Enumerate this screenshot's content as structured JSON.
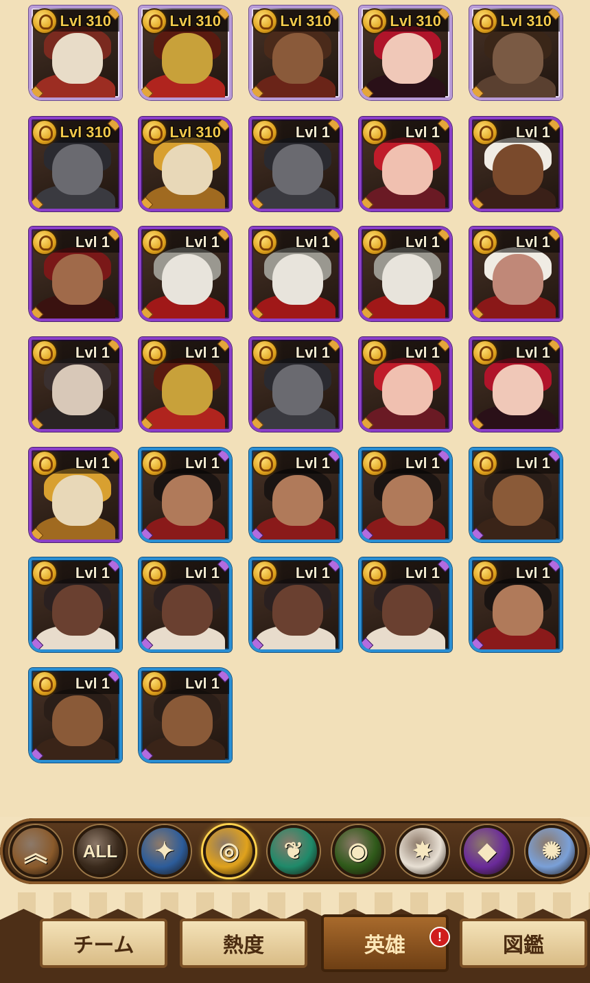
{
  "heroes": [
    {
      "level": "Lvl 310",
      "tier": "legend",
      "skin": "#e8dcc8",
      "hair": "#7a2a1f",
      "body": "#9c2d22"
    },
    {
      "level": "Lvl 310",
      "tier": "legend",
      "skin": "#c8a13a",
      "hair": "#5a1a10",
      "body": "#b0241e"
    },
    {
      "level": "Lvl 310",
      "tier": "legend",
      "skin": "#8a5a3a",
      "hair": "#4a2a1a",
      "body": "#6a2418"
    },
    {
      "level": "Lvl 310",
      "tier": "legend",
      "skin": "#f0c8b8",
      "hair": "#b0142a",
      "body": "#2a1018"
    },
    {
      "level": "Lvl 310",
      "tier": "legend",
      "skin": "#7a5a44",
      "hair": "#3a2618",
      "body": "#5a4030"
    },
    {
      "level": "Lvl 310",
      "tier": "purple",
      "skin": "#6a6a70",
      "hair": "#2a2a30",
      "body": "#3a3a40"
    },
    {
      "level": "Lvl 310",
      "tier": "purple",
      "skin": "#e8d8b8",
      "hair": "#d8a030",
      "body": "#a06a20"
    },
    {
      "level": "Lvl 1",
      "tier": "purple",
      "skin": "#6a6a70",
      "hair": "#2a2a30",
      "body": "#3a3a40"
    },
    {
      "level": "Lvl 1",
      "tier": "purple",
      "skin": "#f0c0b0",
      "hair": "#c01c2a",
      "body": "#6a1a24"
    },
    {
      "level": "Lvl 1",
      "tier": "purple",
      "skin": "#7a4a2c",
      "hair": "#f0ece4",
      "body": "#3a2018"
    },
    {
      "level": "Lvl 1",
      "tier": "purple",
      "skin": "#a06a4a",
      "hair": "#7a1818",
      "body": "#3a1210"
    },
    {
      "level": "Lvl 1",
      "tier": "purple",
      "skin": "#e8e4dc",
      "hair": "#9a9890",
      "body": "#a01818"
    },
    {
      "level": "Lvl 1",
      "tier": "purple",
      "skin": "#e8e4dc",
      "hair": "#9a9890",
      "body": "#a01818"
    },
    {
      "level": "Lvl 1",
      "tier": "purple",
      "skin": "#e8e4dc",
      "hair": "#9a9890",
      "body": "#a01818"
    },
    {
      "level": "Lvl 1",
      "tier": "purple",
      "skin": "#c08878",
      "hair": "#f0ece4",
      "body": "#8a1818"
    },
    {
      "level": "Lvl 1",
      "tier": "purple",
      "skin": "#d8c8b8",
      "hair": "#3a3030",
      "body": "#2a2424"
    },
    {
      "level": "Lvl 1",
      "tier": "purple",
      "skin": "#c8a13a",
      "hair": "#5a1a10",
      "body": "#b0241e"
    },
    {
      "level": "Lvl 1",
      "tier": "purple",
      "skin": "#6a6a70",
      "hair": "#2a2a30",
      "body": "#3a3a40"
    },
    {
      "level": "Lvl 1",
      "tier": "purple",
      "skin": "#f0c0b0",
      "hair": "#c01c2a",
      "body": "#6a1a24"
    },
    {
      "level": "Lvl 1",
      "tier": "purple",
      "skin": "#f0c8b8",
      "hair": "#b0142a",
      "body": "#2a1018"
    },
    {
      "level": "Lvl 1",
      "tier": "purple",
      "skin": "#e8d8b8",
      "hair": "#d8a030",
      "body": "#a06a20"
    },
    {
      "level": "Lvl 1",
      "tier": "blue",
      "skin": "#b07a5a",
      "hair": "#1a1412",
      "body": "#8a1a1a"
    },
    {
      "level": "Lvl 1",
      "tier": "blue",
      "skin": "#b07a5a",
      "hair": "#1a1412",
      "body": "#8a1a1a"
    },
    {
      "level": "Lvl 1",
      "tier": "blue",
      "skin": "#b07a5a",
      "hair": "#1a1412",
      "body": "#8a1a1a"
    },
    {
      "level": "Lvl 1",
      "tier": "blue",
      "skin": "#8a5a38",
      "hair": "#2a1e18",
      "body": "#3a2418"
    },
    {
      "level": "Lvl 1",
      "tier": "blue",
      "skin": "#6a4030",
      "hair": "#2a2020",
      "body": "#e8dccc"
    },
    {
      "level": "Lvl 1",
      "tier": "blue",
      "skin": "#6a4030",
      "hair": "#2a2020",
      "body": "#e8dccc"
    },
    {
      "level": "Lvl 1",
      "tier": "blue",
      "skin": "#6a4030",
      "hair": "#2a2020",
      "body": "#e8dccc"
    },
    {
      "level": "Lvl 1",
      "tier": "blue",
      "skin": "#6a4030",
      "hair": "#2a2020",
      "body": "#e8dccc"
    },
    {
      "level": "Lvl 1",
      "tier": "blue",
      "skin": "#b07a5a",
      "hair": "#1a1412",
      "body": "#8a1a1a"
    },
    {
      "level": "Lvl 1",
      "tier": "blue",
      "skin": "#8a5a38",
      "hair": "#2a1e18",
      "body": "#3a2418"
    },
    {
      "level": "Lvl 1",
      "tier": "blue",
      "skin": "#8a5a38",
      "hair": "#2a1e18",
      "body": "#3a2418"
    }
  ],
  "filters": [
    {
      "name": "collapse-chevron-icon",
      "glyph": "︽",
      "bg": "#8a5a2b",
      "active": false
    },
    {
      "name": "filter-all-icon",
      "glyph": "ALL",
      "bg": "#3a2a1c",
      "active": false
    },
    {
      "name": "lightbearer-faction-icon",
      "glyph": "✦",
      "bg": "#2c5c9a",
      "active": false
    },
    {
      "name": "mauler-faction-icon",
      "glyph": "◎",
      "bg": "#e0a21c",
      "active": true
    },
    {
      "name": "wilder-faction-icon",
      "glyph": "❦",
      "bg": "#1f8a6a",
      "active": false
    },
    {
      "name": "graveborn-faction-icon",
      "glyph": "◉",
      "bg": "#2f5a1a",
      "active": false
    },
    {
      "name": "celestial-faction-icon",
      "glyph": "✸",
      "bg": "#e8e0d4",
      "active": false
    },
    {
      "name": "hypogean-faction-icon",
      "glyph": "◆",
      "bg": "#6a2a9a",
      "active": false
    },
    {
      "name": "dimensional-faction-icon",
      "glyph": "✺",
      "bg": "#7aa0d8",
      "active": false
    }
  ],
  "tabs": [
    {
      "label": "チーム",
      "active": false
    },
    {
      "label": "熱度",
      "active": false
    },
    {
      "label": "英雄",
      "active": true
    },
    {
      "label": "図鑑",
      "active": false
    }
  ],
  "alert": "!"
}
